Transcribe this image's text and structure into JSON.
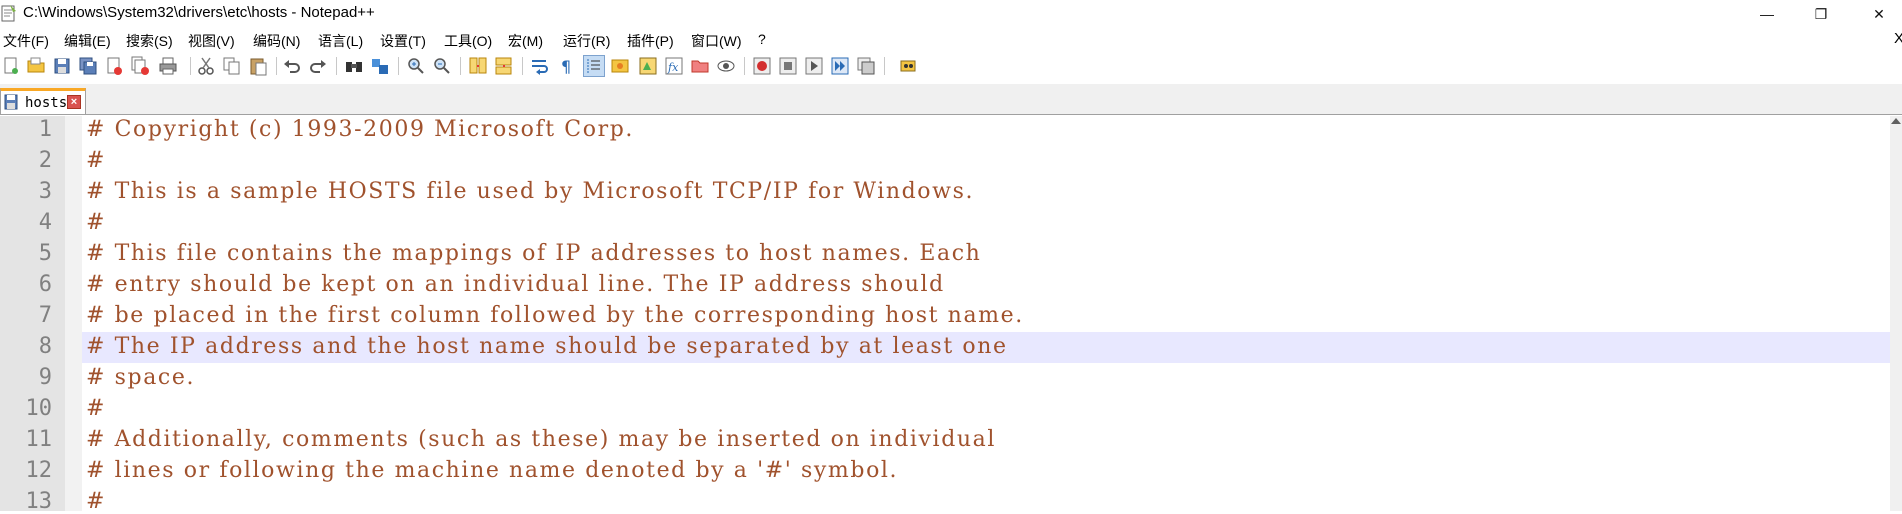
{
  "window": {
    "title": "C:\\Windows\\System32\\drivers\\etc\\hosts - Notepad++",
    "minimize": "—",
    "maximize": "❐",
    "close": "✕"
  },
  "menu": {
    "items": [
      "文件(F)",
      "编辑(E)",
      "搜索(S)",
      "视图(V)",
      "编码(N)",
      "语言(L)",
      "设置(T)",
      "工具(O)",
      "宏(M)",
      "运行(R)",
      "插件(P)",
      "窗口(W)",
      "?"
    ],
    "close_label": "X"
  },
  "toolbar": {
    "icons": [
      "new-file",
      "open-file",
      "save",
      "save-all",
      "close",
      "close-all",
      "print",
      "cut",
      "copy",
      "paste",
      "undo",
      "redo",
      "find",
      "replace",
      "zoom-in",
      "zoom-out",
      "sync-vertical",
      "sync-horizontal",
      "word-wrap",
      "show-all-chars",
      "indent-guide",
      "user-defined-lang",
      "doc-map",
      "function-list",
      "folder-as-workspace",
      "monitoring",
      "record-macro",
      "stop-macro",
      "play-macro",
      "run-macro-multiple",
      "save-macro",
      "spell-check"
    ]
  },
  "tabs": [
    {
      "label": "hosts",
      "active": true
    }
  ],
  "editor": {
    "current_line": 8,
    "lines": [
      {
        "num": "1",
        "text": "# Copyright (c) 1993-2009 Microsoft Corp."
      },
      {
        "num": "2",
        "text": "#"
      },
      {
        "num": "3",
        "text": "# This is a sample HOSTS file used by Microsoft TCP/IP for Windows."
      },
      {
        "num": "4",
        "text": "#"
      },
      {
        "num": "5",
        "text": "# This file contains the mappings of IP addresses to host names. Each"
      },
      {
        "num": "6",
        "text": "# entry should be kept on an individual line. The IP address should"
      },
      {
        "num": "7",
        "text": "# be placed in the first column followed by the corresponding host name."
      },
      {
        "num": "8",
        "text": "# The IP address and the host name should be separated by at least one"
      },
      {
        "num": "9",
        "text": "# space."
      },
      {
        "num": "10",
        "text": "#"
      },
      {
        "num": "11",
        "text": "# Additionally, comments (such as these) may be inserted on individual"
      },
      {
        "num": "12",
        "text": "# lines or following the machine name denoted by a '#' symbol."
      },
      {
        "num": "13",
        "text": "#"
      }
    ]
  },
  "colors": {
    "comment": "#a0522d",
    "line_number": "#808080",
    "gutter": "#e4e4e4",
    "current_line": "#e8e8ff",
    "tab_accent": "#f9a825"
  }
}
